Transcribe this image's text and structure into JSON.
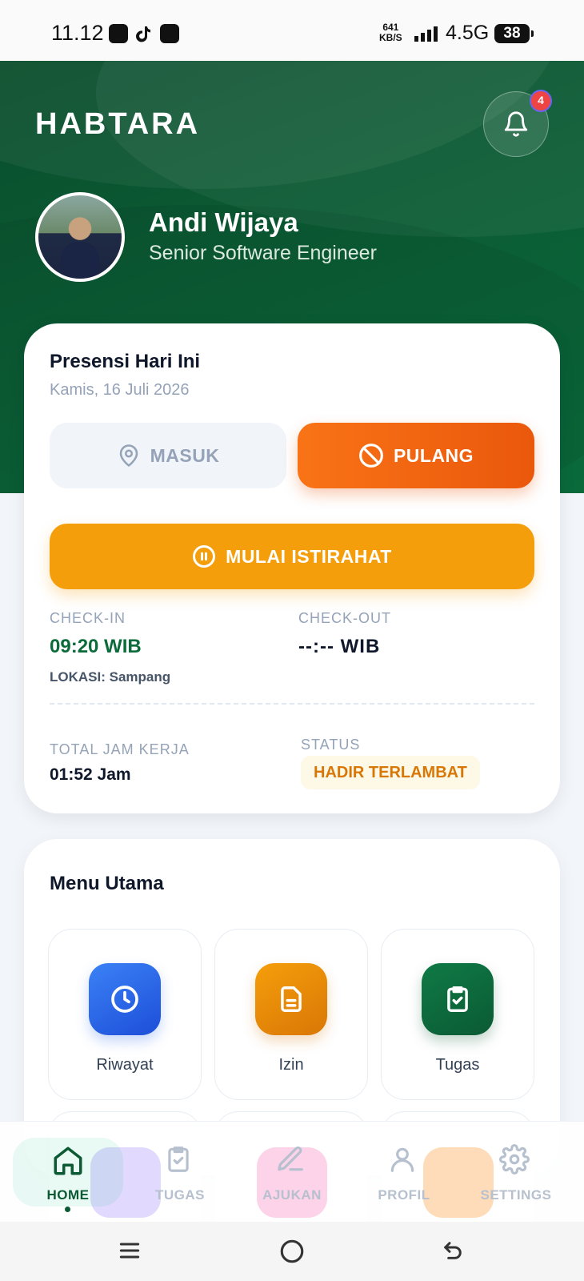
{
  "status_bar": {
    "time": "11.12",
    "speed_value": "641",
    "speed_unit": "KB/S",
    "network": "4.5G",
    "battery": "38"
  },
  "header": {
    "brand": "HABTARA",
    "notification_count": "4",
    "user_name": "Andi Wijaya",
    "user_role": "Senior Software Engineer"
  },
  "attendance": {
    "title": "Presensi Hari Ini",
    "date": "Kamis, 16 Juli 2026",
    "masuk_label": "MASUK",
    "pulang_label": "PULANG",
    "break_label": "MULAI ISTIRAHAT",
    "checkin_label": "CHECK-IN",
    "checkin_value": "09:20 WIB",
    "location": "LOKASI: Sampang",
    "checkout_label": "CHECK-OUT",
    "checkout_value": "--:-- WIB",
    "total_label": "TOTAL JAM KERJA",
    "total_value": "01:52 Jam",
    "status_label": "STATUS",
    "status_value": "HADIR TERLAMBAT"
  },
  "menu": {
    "title": "Menu Utama",
    "items": [
      {
        "label": "Riwayat",
        "icon": "clock-icon",
        "color": "#2563eb"
      },
      {
        "label": "Izin",
        "icon": "document-icon",
        "color": "#d97706"
      },
      {
        "label": "Tugas",
        "icon": "clipboard-check-icon",
        "color": "#0b6b3a"
      }
    ]
  },
  "nav": {
    "items": [
      {
        "label": "HOME",
        "icon": "home-icon"
      },
      {
        "label": "TUGAS",
        "icon": "clipboard-check-icon"
      },
      {
        "label": "AJUKAN",
        "icon": "edit-icon"
      },
      {
        "label": "PROFIL",
        "icon": "user-icon"
      },
      {
        "label": "SETTINGS",
        "icon": "gear-icon"
      }
    ]
  },
  "colors": {
    "primary_green": "#0b5a34",
    "orange": "#f97316",
    "amber": "#f59e0b",
    "status_amber": "#d97706"
  }
}
